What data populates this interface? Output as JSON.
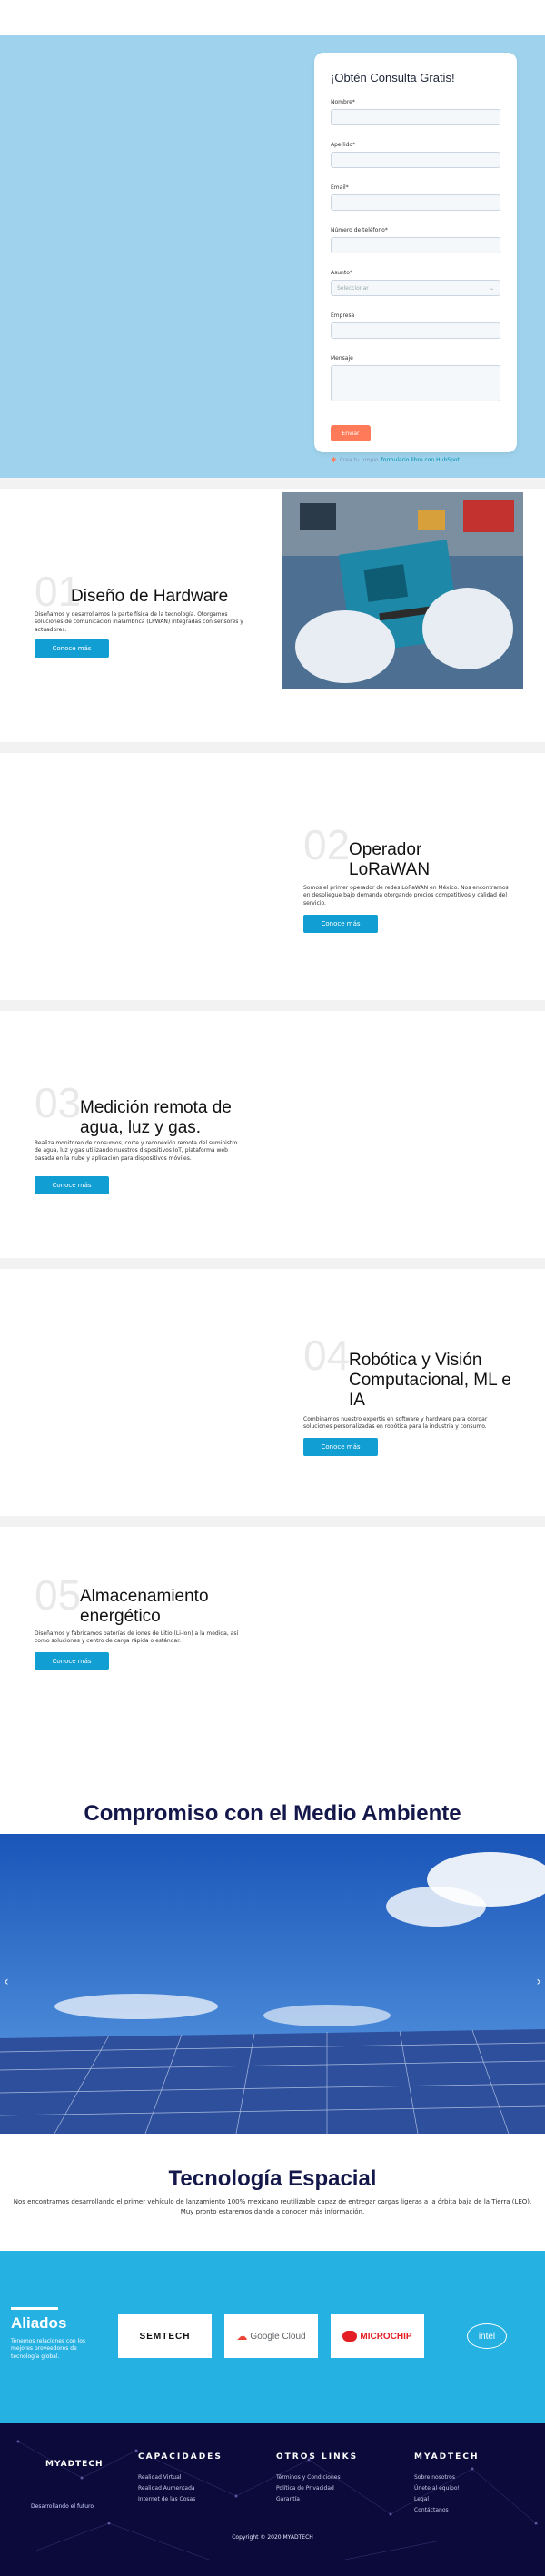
{
  "form": {
    "title": "¡Obtén Consulta Gratis!",
    "fields": {
      "nombre": "Nombre*",
      "apellido": "Apellido*",
      "email": "Email*",
      "telefono": "Número de teléfono*",
      "asunto": "Asunto*",
      "asunto_placeholder": "Seleccionar",
      "empresa": "Empresa",
      "mensaje": "Mensaje"
    },
    "submit": "Enviar",
    "hubspot_prefix": "Crea tu propio",
    "hubspot_link": "formulario libre con HubSpot"
  },
  "services": [
    {
      "num": "01",
      "title": "Diseño de Hardware",
      "desc": "Diseñamos y desarrollamos la parte física de la tecnología. Otorgamos soluciones de comunicación inalámbrica (LPWAN) integradas con sensores y actuadores.",
      "button": "Conoce más"
    },
    {
      "num": "02",
      "title": "Operador LoRaWAN",
      "desc": "Somos el primer operador de redes LoRaWAN en México. Nos encontramos en despliegue bajo demanda otorgando precios competitivos y calidad del servicio.",
      "button": "Conoce más"
    },
    {
      "num": "03",
      "title": "Medición remota de agua, luz y gas.",
      "desc": "Realiza monitoreo de consumos, corte y reconexión remota del suministro de agua, luz y gas utilizando nuestros dispositivos IoT, plataforma web basada en la nube y aplicación para dispositivos móviles.",
      "button": "Conoce más"
    },
    {
      "num": "04",
      "title": "Robótica y Visión Computacional, ML e IA",
      "desc": "Combinamos nuestro expertis en software y hardware para otorgar soluciones personalizadas en robótica para la industria y consumo.",
      "button": "Conoce más"
    },
    {
      "num": "05",
      "title": "Almacenamiento energético",
      "desc": "Diseñamos y fabricamos baterías de iones de Litio (Li-Ion) a la medida, así como soluciones y centro de carga rápida o estándar.",
      "button": "Conoce más"
    }
  ],
  "environment": {
    "title": "Compromiso con el Medio Ambiente"
  },
  "space": {
    "title": "Tecnología Espacial",
    "text": "Nos encontramos desarrollando el primer vehículo de lanzamiento 100% mexicano reutilizable capaz de entregar cargas ligeras a la órbita baja de la Tierra (LEO). Muy pronto estaremos dando a conocer más información."
  },
  "allies": {
    "title": "Aliados",
    "desc": "Tenemos relaciones con los mejores proveedores de tecnología global.",
    "logos": [
      "SEMTECH",
      "Google Cloud",
      "MICROCHIP",
      "intel"
    ]
  },
  "footer": {
    "logo": "MYADTECH",
    "slogan": "Desarrollando el futuro",
    "columns": [
      {
        "title": "CAPACIDADES",
        "items": [
          "Realidad Virtual",
          "Realidad Aumentada",
          "Internet de las Cosas"
        ]
      },
      {
        "title": "OTROS LINKS",
        "items": [
          "Términos y Condiciones",
          "Política de Privacidad",
          "Garantía"
        ]
      },
      {
        "title": "MYADTECH",
        "items": [
          "Sobre nosotros",
          "Únete al equipo!",
          "Legal",
          "Contáctanos"
        ]
      }
    ],
    "copyright": "Copyright © 2020 MYADTECH"
  },
  "colors": {
    "hero_bg": "#9fd3ed",
    "accent": "#119ed2",
    "allies_bg": "#26b1e3",
    "footer_bg": "#0b0a3a",
    "submit": "#ff7a59"
  }
}
